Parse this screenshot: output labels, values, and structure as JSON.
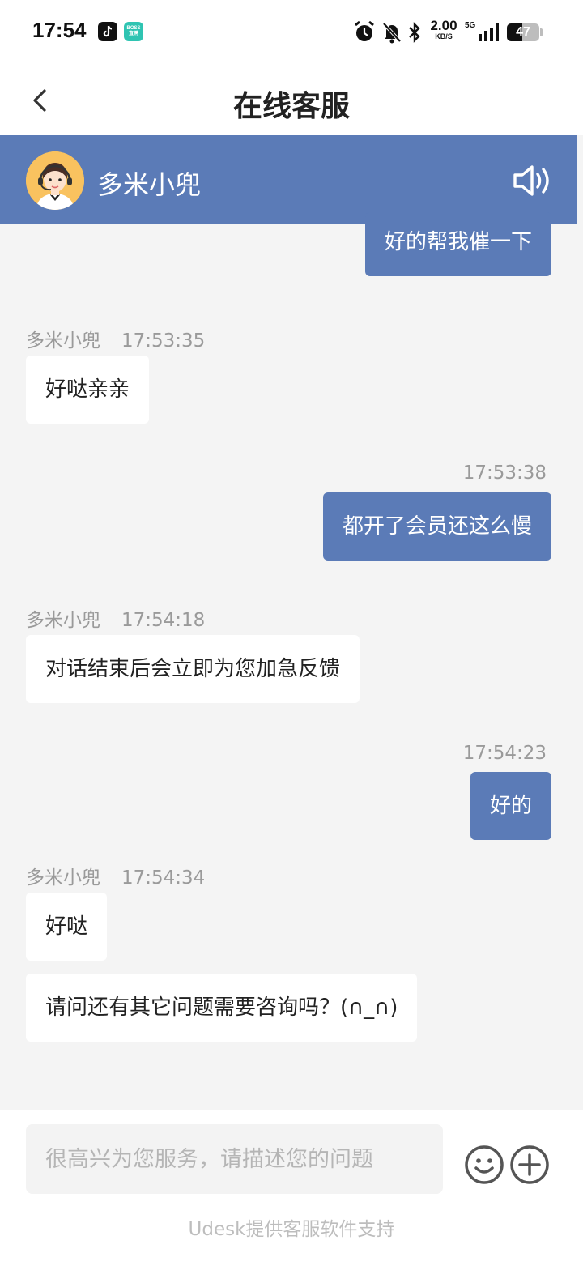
{
  "status_bar": {
    "time": "17:54",
    "net_speed_value": "2.00",
    "net_speed_unit": "KB/S",
    "network_type": "5G",
    "battery_level": 47,
    "battery_text": "47",
    "boss_label": "BOSS\n直聘"
  },
  "header": {
    "title": "在线客服"
  },
  "agent": {
    "name": "多米小兜",
    "header_color": "#5b7bb7"
  },
  "messages": [
    {
      "from": "user",
      "text": "好的帮我催一下"
    },
    {
      "from": "agent",
      "sender": "多米小兜",
      "time": "17:53:35",
      "text": "好哒亲亲"
    },
    {
      "from": "user",
      "time": "17:53:38",
      "text": "都开了会员还这么慢"
    },
    {
      "from": "agent",
      "sender": "多米小兜",
      "time": "17:54:18",
      "text": "对话结束后会立即为您加急反馈"
    },
    {
      "from": "user",
      "time": "17:54:23",
      "text": "好的"
    },
    {
      "from": "agent",
      "sender": "多米小兜",
      "time": "17:54:34",
      "text": "好哒"
    },
    {
      "from": "agent",
      "text": "请问还有其它问题需要咨询吗？(∩_∩)"
    }
  ],
  "input": {
    "placeholder": "很高兴为您服务，请描述您的问题",
    "value": ""
  },
  "footer": {
    "powered_by": "Udesk提供客服软件支持"
  },
  "icons": {
    "back": "chevron-left-icon",
    "speaker": "speaker-icon",
    "emoji": "smiley-icon",
    "plus": "plus-circle-icon"
  }
}
